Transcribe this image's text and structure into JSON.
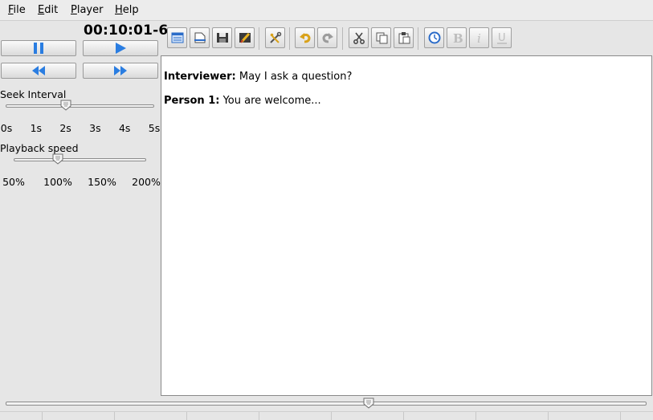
{
  "menu": {
    "items": [
      {
        "mnemonic": "F",
        "rest": "ile"
      },
      {
        "mnemonic": "E",
        "rest": "dit"
      },
      {
        "mnemonic": "P",
        "rest": "layer"
      },
      {
        "mnemonic": "H",
        "rest": "elp"
      }
    ]
  },
  "player": {
    "time": "00:10:01-6",
    "seek_interval": {
      "label": "Seek Interval",
      "ticks": [
        "0s",
        "1s",
        "2s",
        "3s",
        "4s",
        "5s"
      ],
      "value_index": 2
    },
    "playback_speed": {
      "label": "Playback speed",
      "ticks": [
        "50%",
        "100%",
        "150%",
        "200%"
      ],
      "value_index": 1
    },
    "position_fraction": 0.567
  },
  "toolbar": {
    "icons": [
      "new-document-icon",
      "open-document-icon",
      "save-icon",
      "save-as-icon",
      "settings-icon",
      "undo-icon",
      "redo-icon",
      "cut-icon",
      "copy-icon",
      "paste-icon",
      "insert-timestamp-icon",
      "bold-icon",
      "italic-icon",
      "underline-icon"
    ]
  },
  "transcript": [
    {
      "speaker": "Interviewer:",
      "text": " May I ask a question?"
    },
    {
      "speaker": "Person 1:",
      "text": " You are welcome..."
    }
  ],
  "colors": {
    "accent_blue": "#2a7de1",
    "undo_gold": "#d9a21b"
  }
}
